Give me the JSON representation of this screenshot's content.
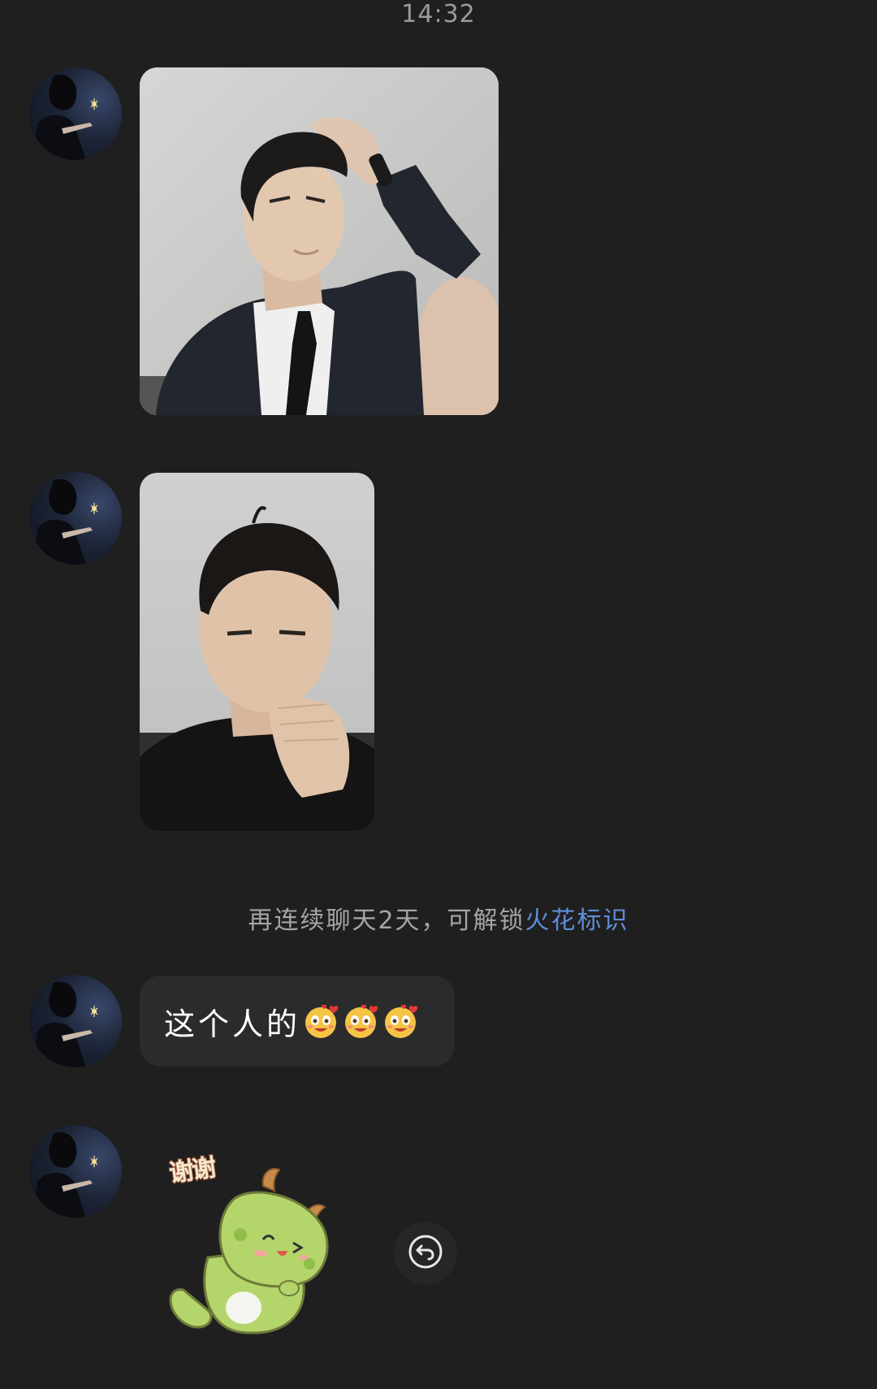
{
  "status": {
    "time": "14:32"
  },
  "messages": [
    {
      "type": "image",
      "sender": "contact",
      "description": "photo"
    },
    {
      "type": "image",
      "sender": "contact",
      "description": "photo"
    },
    {
      "type": "system"
    },
    {
      "type": "text",
      "sender": "contact",
      "emoji_count": 3
    },
    {
      "type": "sticker",
      "sender": "contact"
    }
  ],
  "system_tip": {
    "prefix": "再连续聊天2天，可解锁",
    "link": "火花标识"
  },
  "text_message": {
    "text": "这个人的",
    "emoji": "hearts-face-emoji"
  },
  "sticker": {
    "caption": "谢谢",
    "subject": "green-dragon-sticker"
  },
  "icons": {
    "reply": "reply-arrow-icon"
  },
  "colors": {
    "background": "#1f1f1f",
    "bubble": "#2b2b2b",
    "link": "#5f8ed6",
    "muted_text": "#a5a5a5"
  }
}
